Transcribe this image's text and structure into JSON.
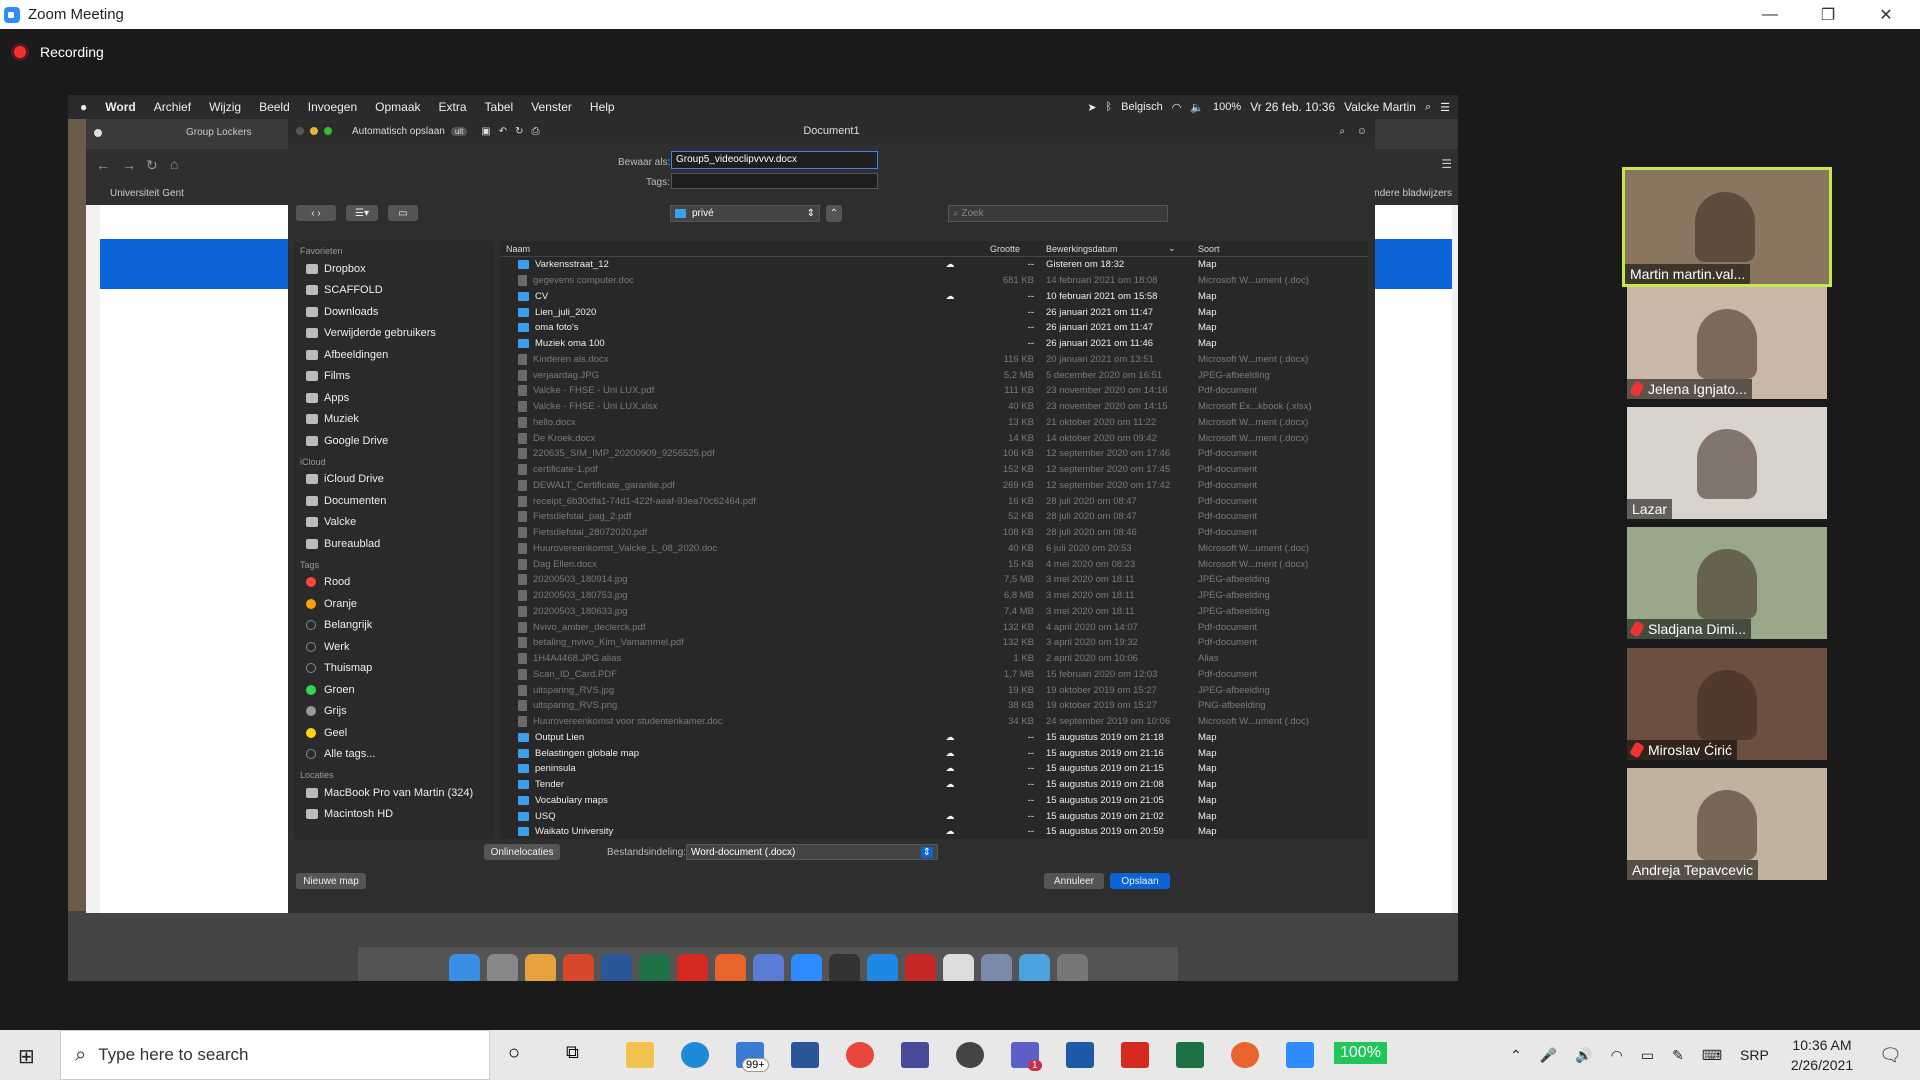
{
  "window": {
    "title": "Zoom Meeting",
    "minimize": "—",
    "restore": "❐",
    "close": "✕"
  },
  "recording": {
    "label": "Recording"
  },
  "mac_menubar": {
    "apple": "",
    "items": [
      "Word",
      "Archief",
      "Wijzig",
      "Beeld",
      "Invoegen",
      "Opmaak",
      "Extra",
      "Tabel",
      "Venster",
      "Help"
    ],
    "keyboard": "Belgisch",
    "battery": "100%",
    "datetime": "Vr 26 feb. 10:36",
    "user": "Valcke Martin"
  },
  "browser": {
    "tab": "Group Lockers",
    "bookmark1": "Universiteit Gent",
    "bookmark2": "Andere bladwijzers"
  },
  "word": {
    "autosave": "Automatisch opslaan",
    "autosave_state": "uit",
    "doc_title": "Document1"
  },
  "save_dialog": {
    "save_as_label": "Bewaar als:",
    "filename": "Group5_videoclipvvvv.docx",
    "tags_label": "Tags:",
    "location": "privé",
    "search_placeholder": "Zoek",
    "sidebar": {
      "favorites_head": "Favorieten",
      "favorites": [
        "Dropbox",
        "SCAFFOLD",
        "Downloads",
        "Verwijderde gebruikers",
        "Afbeeldingen",
        "Films",
        "Apps",
        "Muziek",
        "Google Drive"
      ],
      "icloud_head": "iCloud",
      "icloud": [
        "iCloud Drive",
        "Documenten",
        "Valcke",
        "Bureaublad"
      ],
      "tags_head": "Tags",
      "tags": [
        {
          "name": "Rood",
          "color": "#ff453a"
        },
        {
          "name": "Oranje",
          "color": "#ff9f0a"
        },
        {
          "name": "Belangrijk",
          "color": "#2a2a2a"
        },
        {
          "name": "Werk",
          "color": "#2a2a2a"
        },
        {
          "name": "Thuismap",
          "color": "#2a2a2a"
        },
        {
          "name": "Groen",
          "color": "#32d74b"
        },
        {
          "name": "Grijs",
          "color": "#98989d"
        },
        {
          "name": "Geel",
          "color": "#ffd60a"
        },
        {
          "name": "Alle tags...",
          "color": "#2a2a2a"
        }
      ],
      "locations_head": "Locaties",
      "locations": [
        "MacBook Pro van Martin (324)",
        "Macintosh HD"
      ]
    },
    "columns": {
      "name": "Naam",
      "size": "Grootte",
      "date": "Bewerkingsdatum",
      "kind": "Soort"
    },
    "files": [
      {
        "n": "Varkensstraat_12",
        "s": "--",
        "d": "Gisteren om 18:32",
        "k": "Map",
        "dir": true,
        "cloud": true
      },
      {
        "n": "gegevens computer.doc",
        "s": "681 KB",
        "d": "14 februari 2021 om 18:08",
        "k": "Microsoft W...ument (.doc)",
        "dir": false
      },
      {
        "n": "CV",
        "s": "--",
        "d": "10 februari 2021 om 15:58",
        "k": "Map",
        "dir": true,
        "cloud": true
      },
      {
        "n": "Lien_juli_2020",
        "s": "--",
        "d": "26 januari 2021 om 11:47",
        "k": "Map",
        "dir": true
      },
      {
        "n": "oma foto's",
        "s": "--",
        "d": "26 januari 2021 om 11:47",
        "k": "Map",
        "dir": true
      },
      {
        "n": "Muziek oma 100",
        "s": "--",
        "d": "26 januari 2021 om 11:46",
        "k": "Map",
        "dir": true
      },
      {
        "n": "Kinderen als.docx",
        "s": "116 KB",
        "d": "20 januari 2021 om 13:51",
        "k": "Microsoft W...ment (.docx)",
        "dir": false
      },
      {
        "n": "verjaardag.JPG",
        "s": "5,2 MB",
        "d": "5 december 2020 om 16:51",
        "k": "JPEG-afbeelding",
        "dir": false
      },
      {
        "n": "Valcke - FHSE - Uni LUX.pdf",
        "s": "111 KB",
        "d": "23 november 2020 om 14:16",
        "k": "Pdf-document",
        "dir": false
      },
      {
        "n": "Valcke - FHSE - Uni LUX.xlsx",
        "s": "40 KB",
        "d": "23 november 2020 om 14:15",
        "k": "Microsoft Ex...kbook (.xlsx)",
        "dir": false
      },
      {
        "n": "hello.docx",
        "s": "13 KB",
        "d": "21 oktober 2020 om 11:22",
        "k": "Microsoft W...ment (.docx)",
        "dir": false
      },
      {
        "n": "De Kroek.docx",
        "s": "14 KB",
        "d": "14 oktober 2020 om 09:42",
        "k": "Microsoft W...ment (.docx)",
        "dir": false
      },
      {
        "n": "220635_SIM_IMP_20200909_9256525.pdf",
        "s": "106 KB",
        "d": "12 september 2020 om 17:46",
        "k": "Pdf-document",
        "dir": false
      },
      {
        "n": "certificate-1.pdf",
        "s": "152 KB",
        "d": "12 september 2020 om 17:45",
        "k": "Pdf-document",
        "dir": false
      },
      {
        "n": "DEWALT_Certificate_garantie.pdf",
        "s": "269 KB",
        "d": "12 september 2020 om 17:42",
        "k": "Pdf-document",
        "dir": false
      },
      {
        "n": "receipt_6b30dfa1-74d1-422f-aeaf-93ea70c62464.pdf",
        "s": "16 KB",
        "d": "28 juli 2020 om 08:47",
        "k": "Pdf-document",
        "dir": false
      },
      {
        "n": "Fietsdiefstal_pag_2.pdf",
        "s": "52 KB",
        "d": "28 juli 2020 om 08:47",
        "k": "Pdf-document",
        "dir": false
      },
      {
        "n": "Fietsdiefstal_28072020.pdf",
        "s": "108 KB",
        "d": "28 juli 2020 om 08:46",
        "k": "Pdf-document",
        "dir": false
      },
      {
        "n": "Huurovereenkomst_Valcke_L_08_2020.doc",
        "s": "40 KB",
        "d": "6 juli 2020 om 20:53",
        "k": "Microsoft W...ument (.doc)",
        "dir": false
      },
      {
        "n": "Dag Ellen.docx",
        "s": "15 KB",
        "d": "4 mei 2020 om 08:23",
        "k": "Microsoft W...ment (.docx)",
        "dir": false
      },
      {
        "n": "20200503_180914.jpg",
        "s": "7,5 MB",
        "d": "3 mei 2020 om 18:11",
        "k": "JPEG-afbeelding",
        "dir": false
      },
      {
        "n": "20200503_180753.jpg",
        "s": "6,8 MB",
        "d": "3 mei 2020 om 18:11",
        "k": "JPEG-afbeelding",
        "dir": false
      },
      {
        "n": "20200503_180633.jpg",
        "s": "7,4 MB",
        "d": "3 mei 2020 om 18:11",
        "k": "JPEG-afbeelding",
        "dir": false
      },
      {
        "n": "Nvivo_amber_declerck.pdf",
        "s": "132 KB",
        "d": "4 april 2020 om 14:07",
        "k": "Pdf-document",
        "dir": false
      },
      {
        "n": "betaling_nvivo_Kim_Vamammel.pdf",
        "s": "132 KB",
        "d": "3 april 2020 om 19:32",
        "k": "Pdf-document",
        "dir": false
      },
      {
        "n": "1H4A4468.JPG alias",
        "s": "1 KB",
        "d": "2 april 2020 om 10:06",
        "k": "Alias",
        "dir": false
      },
      {
        "n": "Scan_ID_Card.PDF",
        "s": "1,7 MB",
        "d": "15 februari 2020 om 12:03",
        "k": "Pdf-document",
        "dir": false
      },
      {
        "n": "uitsparing_RVS.jpg",
        "s": "19 KB",
        "d": "19 oktober 2019 om 15:27",
        "k": "JPEG-afbeelding",
        "dir": false
      },
      {
        "n": "uitsparing_RVS.png",
        "s": "38 KB",
        "d": "19 oktober 2019 om 15:27",
        "k": "PNG-afbeelding",
        "dir": false
      },
      {
        "n": "Huurovereenkomst voor studentenkamer.doc",
        "s": "34 KB",
        "d": "24 september 2019 om 10:06",
        "k": "Microsoft W...ument (.doc)",
        "dir": false
      },
      {
        "n": "Output Lien",
        "s": "--",
        "d": "15 augustus 2019 om 21:18",
        "k": "Map",
        "dir": true,
        "cloud": true
      },
      {
        "n": "Belastingen globale map",
        "s": "--",
        "d": "15 augustus 2019 om 21:16",
        "k": "Map",
        "dir": true,
        "cloud": true
      },
      {
        "n": "peninsula",
        "s": "--",
        "d": "15 augustus 2019 om 21:15",
        "k": "Map",
        "dir": true,
        "cloud": true
      },
      {
        "n": "Tender",
        "s": "--",
        "d": "15 augustus 2019 om 21:08",
        "k": "Map",
        "dir": true,
        "cloud": true
      },
      {
        "n": "Vocabulary maps",
        "s": "--",
        "d": "15 augustus 2019 om 21:05",
        "k": "Map",
        "dir": true
      },
      {
        "n": "USQ",
        "s": "--",
        "d": "15 augustus 2019 om 21:02",
        "k": "Map",
        "dir": true,
        "cloud": true
      },
      {
        "n": "Waikato University",
        "s": "--",
        "d": "15 augustus 2019 om 20:59",
        "k": "Map",
        "dir": true,
        "cloud": true
      }
    ],
    "online_locations": "Onlinelocaties",
    "format_label": "Bestandsindeling:",
    "format_value": "Word-document (.docx)",
    "new_folder": "Nieuwe map",
    "cancel": "Annuleer",
    "save": "Opslaan"
  },
  "participants": [
    {
      "name": "Martin martin.val...",
      "muted": false,
      "active": true,
      "bg": "#8a7560"
    },
    {
      "name": "Jelena Ignjato...",
      "muted": true,
      "active": false,
      "bg": "#c9b8a8"
    },
    {
      "name": "Lazar",
      "muted": false,
      "active": false,
      "bg": "#d8d4cc"
    },
    {
      "name": "Sladjana Dimi...",
      "muted": true,
      "active": false,
      "bg": "#9aa88a"
    },
    {
      "name": "Miroslav Ćirić",
      "muted": true,
      "active": false,
      "bg": "#6b5040"
    },
    {
      "name": "Andreja Tepavcevic",
      "muted": false,
      "active": false,
      "bg": "#c0b29e"
    }
  ],
  "taskbar": {
    "search_placeholder": "Type here to search",
    "mail_badge": "99+",
    "teams_badge": "1",
    "zoom_level": "100%",
    "lang": "SRP",
    "time": "10:36 AM",
    "date": "2/26/2021"
  }
}
